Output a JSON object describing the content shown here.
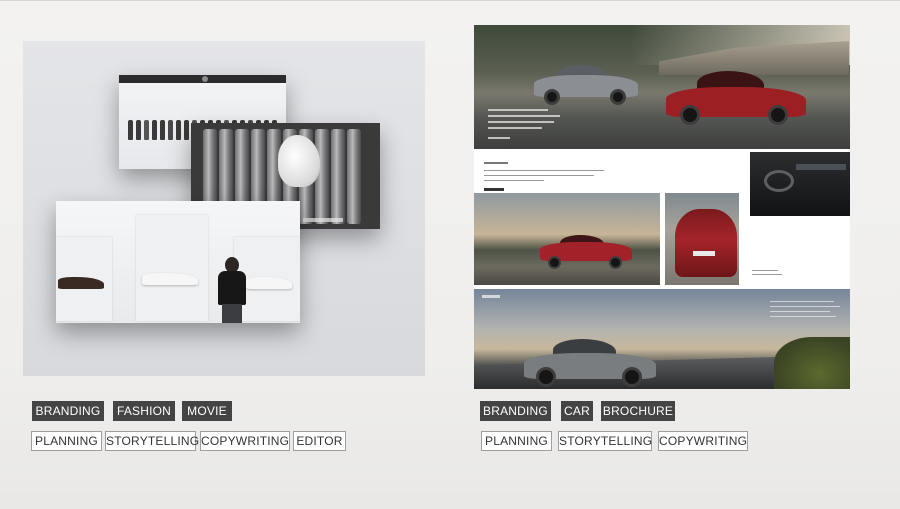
{
  "projects": [
    {
      "categories": [
        "BRANDING",
        "FASHION",
        "MOVIE"
      ],
      "skills": [
        "PLANNING",
        "STORYTELLING",
        "COPYWRITING",
        "EDITOR"
      ]
    },
    {
      "categories": [
        "BRANDING",
        "CAR",
        "BROCHURE"
      ],
      "skills": [
        "PLANNING",
        "STORYTELLING",
        "COPYWRITING"
      ]
    }
  ],
  "colors": {
    "tag_dark_bg": "#444444",
    "tag_dark_text": "#ffffff",
    "tag_light_border": "#9e9e9e",
    "car_red": "#9c1f24",
    "car_gray": "#8b8f93"
  }
}
